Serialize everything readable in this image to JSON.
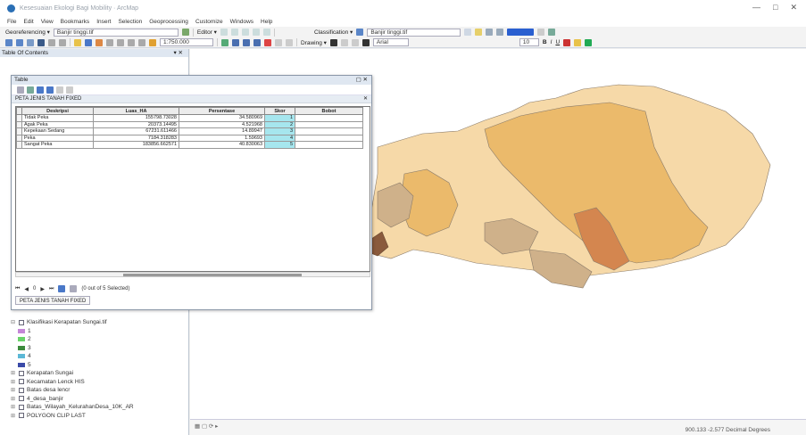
{
  "window": {
    "title": "Kesesuaian Ekologi Bagi Mobility · ArcMap"
  },
  "menu": [
    "File",
    "Edit",
    "View",
    "Bookmarks",
    "Insert",
    "Selection",
    "Geoprocessing",
    "Customize",
    "Windows",
    "Help"
  ],
  "toolbar": {
    "georef_label": "Georeferencing ▾",
    "georef_layer": "Banjir tinggi.tif",
    "editor_label": "Editor ▾",
    "classification_label": "Classification ▾",
    "classification_layer": "Banjir tinggi.tif",
    "scale": "1:750.000",
    "drawing_label": "Drawing ▾",
    "font_name": "Arial",
    "font_size": "10",
    "bold": "B",
    "italic": "I",
    "underline": "U"
  },
  "toc": {
    "header": "Table Of Contents",
    "layers": [
      {
        "label": "Klasifikasi Kerapatan Sungai.tif",
        "expanded": true
      },
      {
        "label": "Kerapatan Sungai"
      },
      {
        "label": "Kecamatan Lenck HIS"
      },
      {
        "label": "Batas desa lencr"
      },
      {
        "label": "4_desa_banjir"
      },
      {
        "label": "Batas_Wilayah_KelurahanDesa_10K_AR"
      },
      {
        "label": "POLYGON CLIP LAST"
      }
    ],
    "legend": [
      {
        "label": "1",
        "color": "#c586d8"
      },
      {
        "label": "2",
        "color": "#6ad46a"
      },
      {
        "label": "3",
        "color": "#3c8a3c"
      },
      {
        "label": "4",
        "color": "#5cb8d6"
      },
      {
        "label": "5",
        "color": "#3a4aa8"
      }
    ]
  },
  "table": {
    "window_title": "Table",
    "tab_name": "PETA JENIS TANAH FIXED",
    "columns": [
      "Deskripsi",
      "Luas_HA",
      "Persentase",
      "Skor",
      "Bobot"
    ],
    "rows": [
      [
        "Tidak Peka",
        "155798.73028",
        "34.580969",
        "1",
        ""
      ],
      [
        "Agak Peka",
        "20373.14495",
        "4.521968",
        "2",
        ""
      ],
      [
        "Kepekaan Sedang",
        "67231.611466",
        "14.89947",
        "3",
        ""
      ],
      [
        "Peka",
        "7184.318283",
        "1.59693",
        "4",
        ""
      ],
      [
        "Sangat Peka",
        "183856.662571",
        "40.830063",
        "5",
        ""
      ]
    ],
    "selection_text": "(0 out of 5 Selected)",
    "record_index": "0",
    "footer_tab": "PETA JENIS TANAH FIXED"
  },
  "status": {
    "coords": "900.133  -2.577 Decimal Degrees"
  },
  "colors": {
    "map_light": "#f6d9a8",
    "map_mid": "#ebba6b",
    "map_dark": "#d4864f",
    "map_tan": "#cfb18a",
    "map_brown": "#8a5a3c"
  }
}
